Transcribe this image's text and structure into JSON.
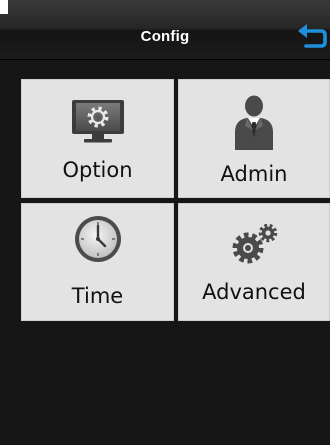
{
  "header": {
    "title": "Config",
    "back_icon": "back-arrow-icon"
  },
  "tiles": [
    {
      "label": "Option",
      "icon": "monitor-gear-icon"
    },
    {
      "label": "Admin",
      "icon": "user-admin-icon"
    },
    {
      "label": "Time",
      "icon": "clock-icon"
    },
    {
      "label": "Advanced",
      "icon": "gears-icon"
    }
  ],
  "colors": {
    "tile_bg": "#e3e3e3",
    "background": "#161616",
    "back_arrow": "#1e8fd8"
  }
}
